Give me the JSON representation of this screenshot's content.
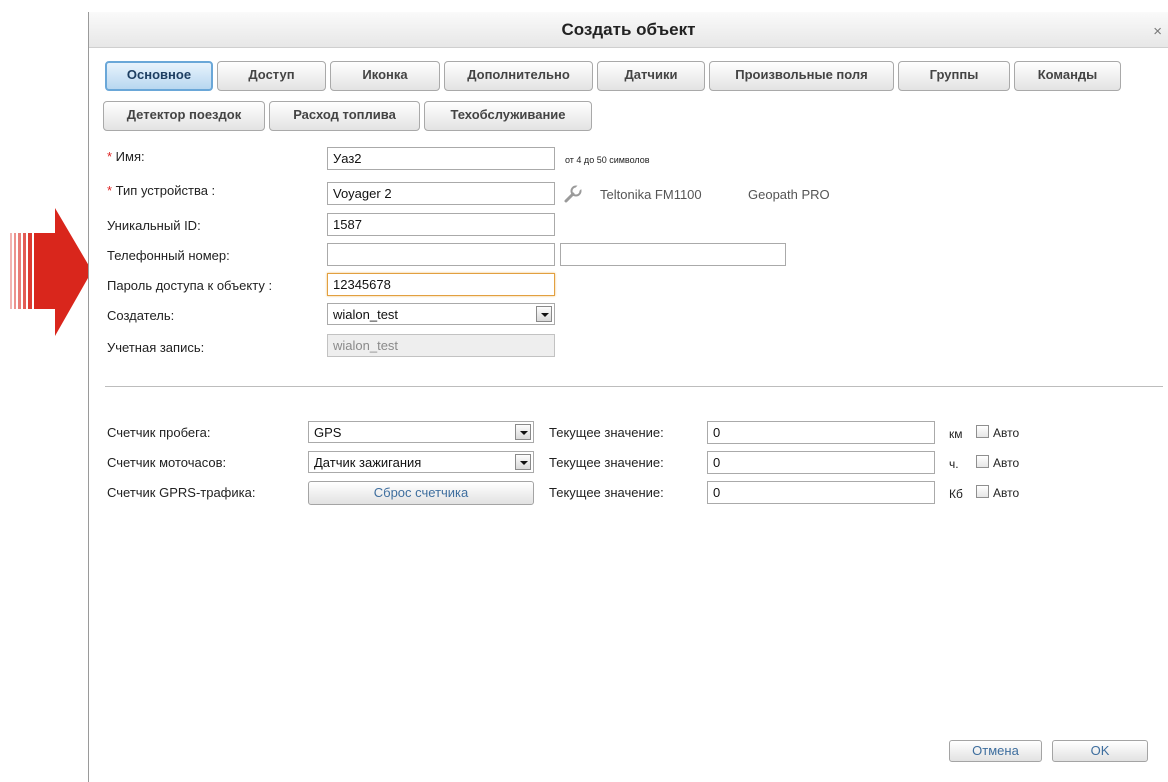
{
  "dialog": {
    "title": "Создать объект",
    "close_icon": "×"
  },
  "tabs": [
    {
      "label": "Основное",
      "active": true
    },
    {
      "label": "Доступ"
    },
    {
      "label": "Иконка"
    },
    {
      "label": "Дополнительно"
    },
    {
      "label": "Датчики"
    },
    {
      "label": "Произвольные поля"
    },
    {
      "label": "Группы"
    },
    {
      "label": "Команды"
    },
    {
      "label": "Детектор поездок"
    },
    {
      "label": "Расход топлива"
    },
    {
      "label": "Техобслуживание"
    }
  ],
  "form": {
    "name": {
      "label_star": "*",
      "label": " Имя:",
      "value": "Уаз2",
      "hint": "от 4 до 50 символов"
    },
    "device_type": {
      "label_star": "*",
      "label": " Тип устройства :",
      "value": "Voyager 2",
      "icon": "wrench-icon",
      "info1": "Teltonika FM1100",
      "info2": "Geopath PRO"
    },
    "unique_id": {
      "label": "Уникальный ID:",
      "value": "1587"
    },
    "phone": {
      "label": "Телефонный номер:",
      "value": "",
      "value2": ""
    },
    "password": {
      "label": "Пароль доступа к объекту :",
      "value": "12345678"
    },
    "creator": {
      "label": "Создатель:",
      "value": "wialon_test"
    },
    "account": {
      "label": "Учетная запись:",
      "value": "wialon_test"
    }
  },
  "counters": {
    "mileage": {
      "label": "Счетчик пробега:",
      "select": "GPS",
      "current_label": "Текущее значение:",
      "value": "0",
      "unit": "км",
      "auto_label": "Авто"
    },
    "engine_hours": {
      "label": "Счетчик моточасов:",
      "select": "Датчик зажигания",
      "current_label": "Текущее значение:",
      "value": "0",
      "unit": "ч.",
      "auto_label": "Авто"
    },
    "gprs": {
      "label": "Счетчик GPRS-трафика:",
      "button": "Сброс счетчика",
      "current_label": "Текущее значение:",
      "value": "0",
      "unit": "Кб",
      "auto_label": "Авто"
    }
  },
  "footer": {
    "cancel": "Отмена",
    "ok": "OK"
  },
  "colors": {
    "arrow": "#d9261c",
    "active_tab": "#b8d7f0",
    "focus_border": "#e2a040"
  }
}
